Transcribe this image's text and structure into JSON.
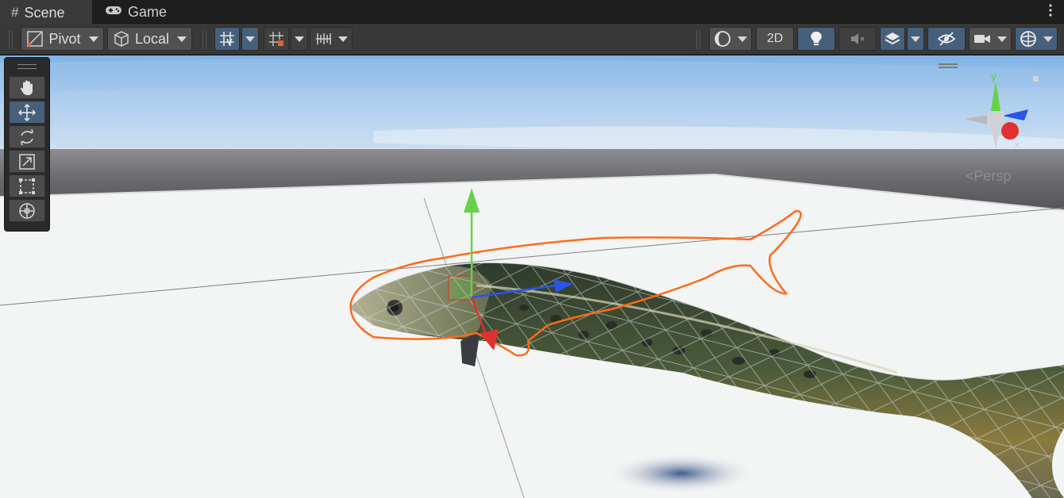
{
  "tabs": [
    {
      "label": "Scene",
      "icon": "grid-hash-icon",
      "active": true
    },
    {
      "label": "Game",
      "icon": "gamepad-icon",
      "active": false
    }
  ],
  "toolbar": {
    "pivot_label": "Pivot",
    "local_label": "Local",
    "mode_2d_label": "2D"
  },
  "viewport": {
    "projection_label": "Persp",
    "gizmo_axis_y": "y",
    "gizmo_axis_x": "x",
    "selection_outline_color": "#ff6a1a",
    "axis_x_color": "#e03030",
    "axis_y_color": "#66d24a",
    "axis_z_color": "#2a55e6"
  },
  "tools": [
    {
      "name": "hand-tool",
      "icon": "hand-icon",
      "active": false
    },
    {
      "name": "move-tool",
      "icon": "move-arrows-icon",
      "active": true
    },
    {
      "name": "rotate-tool",
      "icon": "rotate-icon",
      "active": false
    },
    {
      "name": "scale-tool",
      "icon": "scale-icon",
      "active": false
    },
    {
      "name": "rect-tool",
      "icon": "rect-transform-icon",
      "active": false
    },
    {
      "name": "transform-tool",
      "icon": "transform-icon",
      "active": false
    }
  ],
  "colors": {
    "accent_active": "#46607c",
    "toolbar_bg": "#383838",
    "tab_bg": "#1e1e1e"
  }
}
